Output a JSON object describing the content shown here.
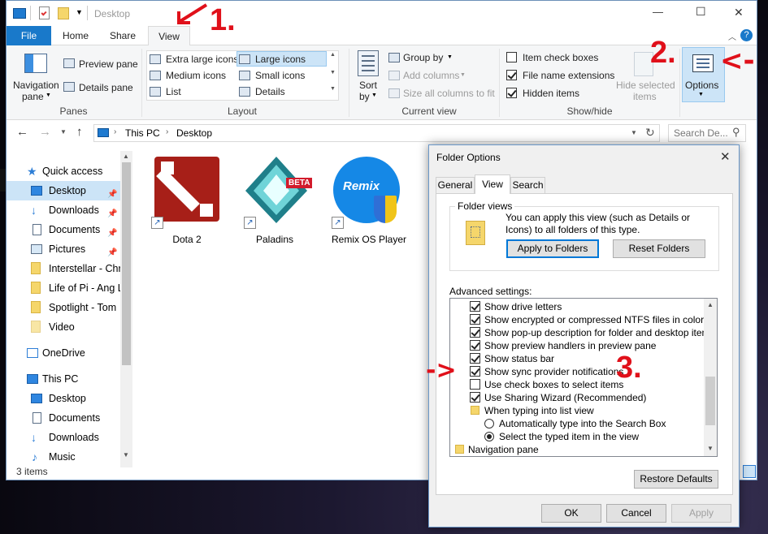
{
  "window": {
    "title": "Desktop",
    "controls": {
      "minimize": "—",
      "maximize": "☐",
      "close": "✕"
    }
  },
  "ribbon": {
    "tabs": [
      {
        "label": "File"
      },
      {
        "label": "Home"
      },
      {
        "label": "Share"
      },
      {
        "label": "View"
      }
    ],
    "help_icon": "?",
    "panes": {
      "navigation_pane": "Navigation",
      "navigation_pane_2": "pane",
      "preview_pane": "Preview pane",
      "details_pane": "Details pane",
      "group_label": "Panes"
    },
    "layout": {
      "items": [
        "Extra large icons",
        "Large icons",
        "Medium icons",
        "Small icons",
        "List",
        "Details"
      ],
      "group_label": "Layout"
    },
    "current_view": {
      "sort": "Sort",
      "sort_2": "by",
      "group_by": "Group by",
      "add_columns": "Add columns",
      "size_all": "Size all columns to fit",
      "group_label": "Current view"
    },
    "show_hide": {
      "item_check_boxes": "Item check boxes",
      "file_name_extensions": "File name extensions",
      "hidden_items": "Hidden items",
      "hide_selected": "Hide selected",
      "hide_selected_2": "items",
      "group_label": "Show/hide"
    },
    "options": "Options"
  },
  "address": {
    "path": [
      "This PC",
      "Desktop"
    ],
    "search_placeholder": "Search De..."
  },
  "nav": {
    "quick_access": "Quick access",
    "items": [
      {
        "label": "Desktop"
      },
      {
        "label": "Downloads"
      },
      {
        "label": "Documents"
      },
      {
        "label": "Pictures"
      },
      {
        "label": "Interstellar - Chr"
      },
      {
        "label": "Life of Pi - Ang L"
      },
      {
        "label": "Spotlight - Tom"
      },
      {
        "label": "Video"
      }
    ],
    "onedrive": "OneDrive",
    "this_pc": "This PC",
    "pc_items": [
      {
        "label": "Desktop"
      },
      {
        "label": "Documents"
      },
      {
        "label": "Downloads"
      },
      {
        "label": "Music"
      }
    ]
  },
  "files": [
    {
      "label": "Dota 2"
    },
    {
      "label": "Paladins",
      "badge": "BETA"
    },
    {
      "label": "Remix OS Player",
      "logo": "Remix"
    }
  ],
  "status": "3 items",
  "dialog": {
    "title": "Folder Options",
    "tabs": [
      "General",
      "View",
      "Search"
    ],
    "folder_views": "Folder views",
    "folder_views_text": "You can apply this view (such as Details or Icons) to all folders of this type.",
    "apply_to_folders": "Apply to Folders",
    "reset_folders": "Reset Folders",
    "advanced_label": "Advanced settings:",
    "advanced": [
      "Show drive letters",
      "Show encrypted or compressed NTFS files in color",
      "Show pop-up description for folder and desktop items",
      "Show preview handlers in preview pane",
      "Show status bar",
      "Show sync provider notifications",
      "Use check boxes to select items",
      "Use Sharing Wizard (Recommended)",
      "When typing into list view",
      "Automatically type into the Search Box",
      "Select the typed item in the view",
      "Navigation pane"
    ],
    "restore_defaults": "Restore Defaults",
    "ok": "OK",
    "cancel": "Cancel",
    "apply": "Apply"
  },
  "annotations": {
    "step1": "1.",
    "step2": "2.",
    "step3": "3."
  },
  "colors": {
    "file_tab": "#1979ca",
    "accent": "#0078d7",
    "annotation_red": "#e0101a"
  }
}
